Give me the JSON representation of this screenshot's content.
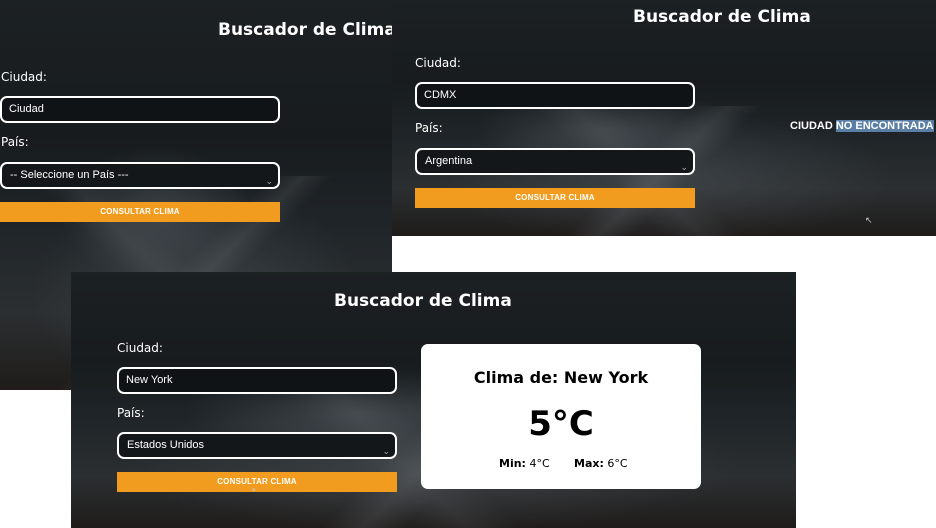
{
  "shots": [
    {
      "title": "Buscador de Clima",
      "city_label": "Ciudad:",
      "city_value": "Ciudad",
      "country_label": "País:",
      "country_selected": "-- Seleccione un País ---",
      "button_label": "Consultar Clima"
    },
    {
      "title": "Buscador de Clima",
      "city_label": "Ciudad:",
      "city_value": "CDMX",
      "country_label": "País:",
      "country_selected": "Argentina",
      "button_label": "Consultar Clima",
      "error_part1": "CIUDAD",
      "error_part2": "NO ENCONTRADA"
    },
    {
      "title": "Buscador de Clima",
      "city_label": "Ciudad:",
      "city_value": "New York",
      "country_label": "País:",
      "country_selected": "Estados Unidos",
      "button_label": "Consultar Clima",
      "result": {
        "title": "Clima de: New York",
        "temp": "5°C",
        "min_label": "Min:",
        "min_value": "4°C",
        "max_label": "Max:",
        "max_value": "6°C"
      }
    }
  ],
  "colors": {
    "button": "#f29c1f",
    "error_highlight": "#5b7ea4",
    "card": "#ffffff"
  },
  "icons": {
    "select_chevron": "chevron-down-icon",
    "cursor": "mouse-pointer-icon"
  }
}
